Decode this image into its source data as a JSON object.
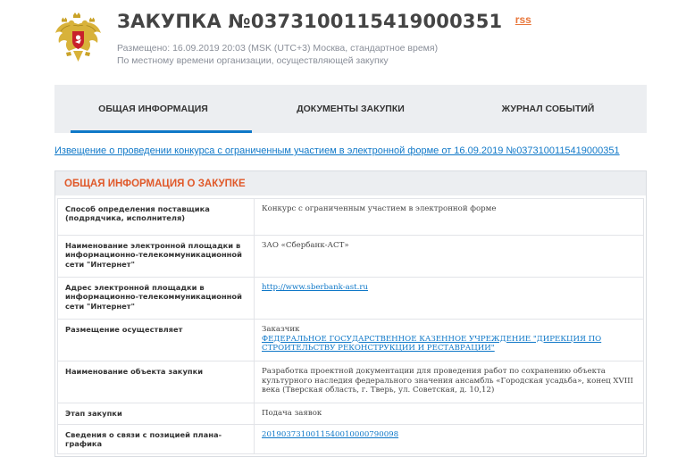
{
  "header": {
    "title": "ЗАКУПКА №0373100115419000351",
    "rss_label": "rss",
    "posted_label": "Размещено:",
    "posted_datetime": "16.09.2019 20:03 (MSK (UTC+3) Москва, стандартное время)",
    "local_time_note": "По местному времени организации, осуществляющей закупку"
  },
  "tabs": [
    {
      "label": "Общая информация",
      "active": true
    },
    {
      "label": "Документы закупки",
      "active": false
    },
    {
      "label": "Журнал событий",
      "active": false
    }
  ],
  "notice_link": "Извещение о проведении конкурса с ограниченным участием в электронной форме от 16.09.2019 №0373100115419000351",
  "section": {
    "title": "Общая информация о закупке",
    "rows": [
      {
        "label": "Способ определения поставщика (подрядчика, исполнителя)",
        "value": "Конкурс с ограниченным участием в электронной форме"
      },
      {
        "label": "Наименование электронной площадки в информационно-телекоммуникационной сети \"Интернет\"",
        "value": "ЗАО «Сбербанк-АСТ»"
      },
      {
        "label": "Адрес электронной площадки в информационно-телекоммуникационной сети \"Интернет\"",
        "value": "http://www.sberbank-ast.ru"
      },
      {
        "label": "Размещение осуществляет",
        "value_prefix": "Заказчик",
        "value": "Федеральное государственное казенное учреждение \"Дирекция по строительству реконструкции и реставрации\""
      },
      {
        "label": "Наименование объекта закупки",
        "value": "Разработка проектной документации для проведения работ по сохранению объекта культурного наследия федерального значения ансамбль «Городская усадьба», конец XVIII века (Тверская область, г. Тверь, ул. Советская, д. 10,12)"
      },
      {
        "label": "Этап закупки",
        "value": "Подача заявок"
      },
      {
        "label": "Сведения о связи с позицией плана-графика",
        "value": "201903731001154001000079009­8"
      }
    ]
  },
  "colors": {
    "accent": "#0f78c8",
    "section_title": "#e0592a",
    "rss": "#e8763a",
    "tab_bg": "#eceef1"
  },
  "icons": {
    "emblem": "russian-coat-of-arms-icon"
  }
}
